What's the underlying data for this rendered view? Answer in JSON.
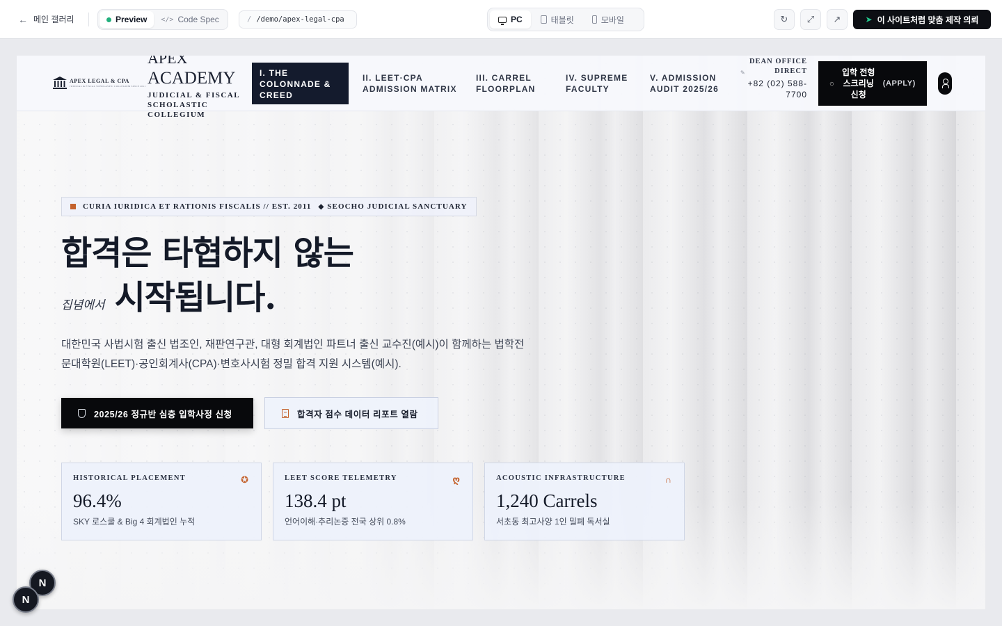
{
  "toolbar": {
    "back_label": "메인 갤러리",
    "view_modes": [
      "Preview",
      "Code Spec"
    ],
    "url_path": "/demo/apex-legal-cpa",
    "devices": [
      "PC",
      "태블릿",
      "모바일"
    ],
    "cta_label": "이 사이트처럼 맞춤 제작 의뢰",
    "icons": [
      "arrow-left-icon",
      "code-icon",
      "monitor-icon",
      "tablet-icon",
      "phone-icon",
      "refresh-icon",
      "expand-icon",
      "external-link-icon",
      "paper-plane-icon"
    ]
  },
  "site": {
    "logo_text": "APEX LEGAL & CPA",
    "logo_subtext": "JUDICIAL & FISCAL SCHOLASTIC COLLEGIUM SINCE 2011",
    "brand_line1": "APEX",
    "brand_line2": "ACADEMY",
    "brand_line3": "JUDICIAL & FISCAL SCHOLASTIC COLLEGIUM",
    "nav": [
      "I. THE COLONNADE & CREED",
      "II. LEET·CPA ADMISSION MATRIX",
      "III. CARREL FLOORPLAN",
      "IV. SUPREME FACULTY",
      "V. ADMISSION AUDIT 2025/26"
    ],
    "dean_label": "DEAN OFFICE DIRECT",
    "dean_phone": "+82 (02) 588-7700",
    "apply_label": "입학 전형 스크리닝 신청",
    "apply_tag": "(APPLY)"
  },
  "hero": {
    "tagline_main": "CURIA IURIDICA ET RATIONIS FISCALIS // EST. 2011",
    "tagline_sub": "SEOCHO JUDICIAL SANCTUARY",
    "headline_line1": "합격은 타협하지 않는",
    "headline_small": "집념에서",
    "headline_line2": "시작됩니다.",
    "description": "대한민국 사법시험 출신 법조인, 재판연구관, 대형 회계법인 파트너 출신 교수진(예시)이 함께하는 법학전문대학원(LEET)·공인회계사(CPA)·변호사시험 정밀 합격 지원 시스템(예시).",
    "primary_cta": "2025/26 정규반 심층 입학사정 신청",
    "secondary_cta": "합격자 점수 데이터 리포트 열람"
  },
  "stats": [
    {
      "label": "HISTORICAL PLACEMENT",
      "value": "96.4%",
      "sub": "SKY 로스쿨 & Big 4 회계법인 누적",
      "icon": "award-icon"
    },
    {
      "label": "LEET SCORE TELEMETRY",
      "value": "138.4 pt",
      "sub": "언어이해·추리논증 전국 상위 0.8%",
      "icon": "brain-icon"
    },
    {
      "label": "ACOUSTIC INFRASTRUCTURE",
      "value": "1,240 Carrels",
      "sub": "서초동 최고사양 1인 밀폐 독서실",
      "icon": "headphones-icon"
    }
  ],
  "badges": [
    "N",
    "N"
  ],
  "colors": {
    "accent": "#c4622d",
    "navy": "#141b2d",
    "black": "#08090c",
    "green": "#22b07d"
  }
}
